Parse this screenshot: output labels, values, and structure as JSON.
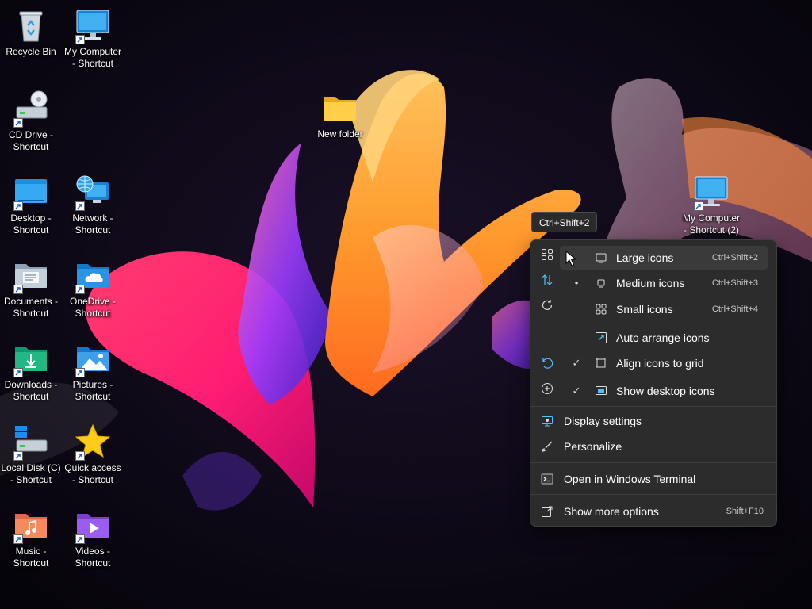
{
  "desktop": {
    "icons": [
      {
        "label": "Recycle Bin",
        "icon": "recycle-bin-icon"
      },
      {
        "label": "My Computer - Shortcut",
        "icon": "computer-monitor-icon"
      },
      {
        "label": "CD Drive - Shortcut",
        "icon": "cd-drive-icon"
      },
      {
        "label": "Desktop - Shortcut",
        "icon": "desktop-folder-icon"
      },
      {
        "label": "Network - Shortcut",
        "icon": "network-globe-icon"
      },
      {
        "label": "Documents - Shortcut",
        "icon": "documents-folder-icon"
      },
      {
        "label": "OneDrive - Shortcut",
        "icon": "onedrive-folder-icon"
      },
      {
        "label": "Downloads - Shortcut",
        "icon": "downloads-folder-icon"
      },
      {
        "label": "Pictures - Shortcut",
        "icon": "pictures-folder-icon"
      },
      {
        "label": "Local Disk (C) - Shortcut",
        "icon": "local-disk-icon"
      },
      {
        "label": "Quick access - Shortcut",
        "icon": "star-icon"
      },
      {
        "label": "Music - Shortcut",
        "icon": "music-folder-icon"
      },
      {
        "label": "Videos - Shortcut",
        "icon": "videos-folder-icon"
      },
      {
        "label": "New folder",
        "icon": "folder-icon"
      },
      {
        "label": "My Computer - Shortcut (2)",
        "icon": "computer-monitor-icon"
      }
    ]
  },
  "tooltip": {
    "text": "Ctrl+Shift+2"
  },
  "context_menu": {
    "command_bar": [
      {
        "icon": "grid-view-icon",
        "tooltip": "View"
      },
      {
        "icon": "sort-arrows-icon",
        "tooltip": "Sort by"
      },
      {
        "icon": "refresh-icon",
        "tooltip": "Refresh"
      },
      {
        "icon": "undo-icon",
        "tooltip": "Undo"
      },
      {
        "icon": "new-plus-icon",
        "tooltip": "New"
      }
    ],
    "view_submenu": [
      {
        "label": "Large icons",
        "shortcut": "Ctrl+Shift+2",
        "mark": "",
        "icon": "large-icons-icon",
        "hovered": true
      },
      {
        "label": "Medium icons",
        "shortcut": "Ctrl+Shift+3",
        "mark": "•",
        "icon": "medium-icons-icon"
      },
      {
        "label": "Small icons",
        "shortcut": "Ctrl+Shift+4",
        "mark": "",
        "icon": "small-icons-icon"
      },
      {
        "label": "Auto arrange icons",
        "shortcut": "",
        "mark": "",
        "icon": "auto-arrange-icon"
      },
      {
        "label": "Align icons to grid",
        "shortcut": "",
        "mark": "✓",
        "icon": "align-grid-icon"
      },
      {
        "label": "Show desktop icons",
        "shortcut": "",
        "mark": "✓",
        "icon": "show-desktop-icon"
      }
    ],
    "items": [
      {
        "label": "Display settings",
        "shortcut": "",
        "icon": "display-settings-icon"
      },
      {
        "label": "Personalize",
        "shortcut": "",
        "icon": "paintbrush-icon"
      },
      {
        "label": "Open in Windows Terminal",
        "shortcut": "",
        "icon": "terminal-icon"
      },
      {
        "label": "Show more options",
        "shortcut": "Shift+F10",
        "icon": "show-more-options-icon"
      }
    ]
  },
  "colors": {
    "menu_bg": "#2c2c2c",
    "accent": "#4cc2ff",
    "hover": "#3a3a3a"
  }
}
